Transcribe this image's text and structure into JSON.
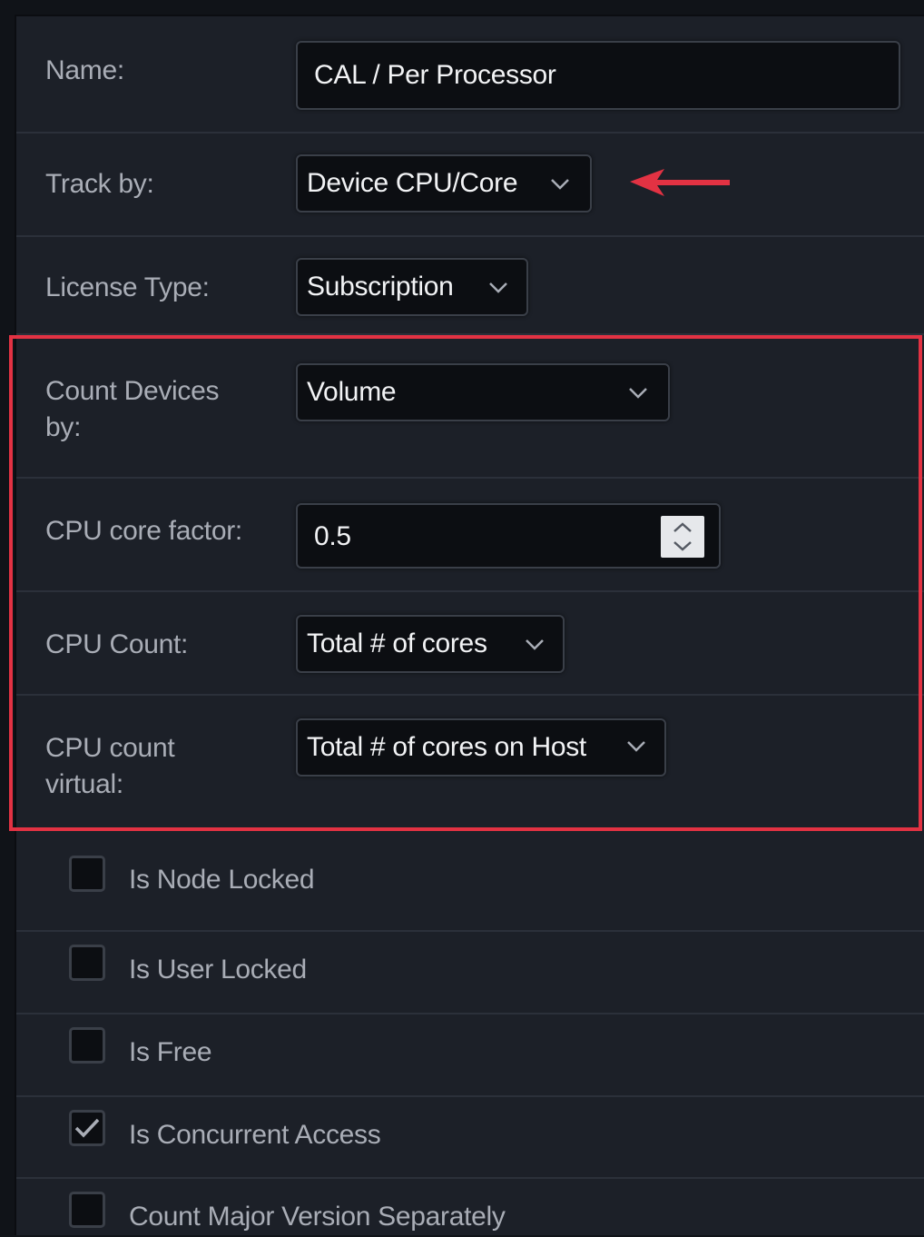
{
  "form": {
    "name": {
      "label": "Name:",
      "value": "CAL / Per Processor"
    },
    "track_by": {
      "label": "Track by:",
      "value": "Device CPU/Core"
    },
    "license_type": {
      "label": "License Type:",
      "value": "Subscription"
    },
    "count_devices_by": {
      "label_line1": "Count Devices",
      "label_line2": "by:",
      "value": "Volume"
    },
    "cpu_core_factor": {
      "label": "CPU core factor:",
      "value": "0.5"
    },
    "cpu_count": {
      "label": "CPU Count:",
      "value": "Total # of cores"
    },
    "cpu_count_virtual": {
      "label_line1": "CPU count",
      "label_line2": "virtual:",
      "value": "Total # of cores on Host"
    }
  },
  "checkboxes": [
    {
      "label": "Is Node Locked",
      "checked": false
    },
    {
      "label": "Is User Locked",
      "checked": false
    },
    {
      "label": "Is Free",
      "checked": false
    },
    {
      "label": "Is Concurrent Access",
      "checked": true
    },
    {
      "label": "Count Major Version Separately",
      "checked": false
    }
  ],
  "colors": {
    "highlight": "#e23243",
    "arrow": "#e23243",
    "background": "#1c2028"
  },
  "icons": {
    "dropdown": "chevron-down-icon",
    "spinner": "spinner-arrows-icon",
    "check": "checkmark-icon",
    "annotation": "arrow-left-icon"
  }
}
